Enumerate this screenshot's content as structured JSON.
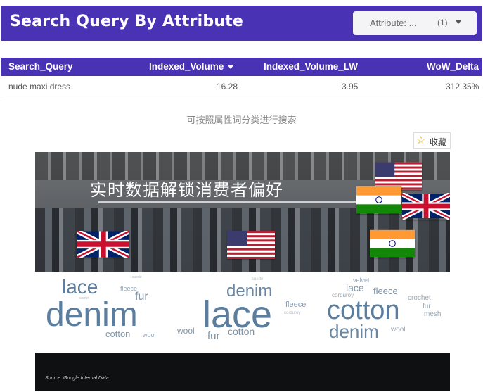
{
  "header": {
    "title": "Search Query By Attribute"
  },
  "attribute_select": {
    "label": "Attribute: ...",
    "count": "(1)"
  },
  "table": {
    "columns": [
      "Search_Query",
      "Indexed_Volume",
      "Indexed_Volume_LW",
      "WoW_Delta"
    ],
    "rows": [
      {
        "query": "nude maxi dress",
        "indexed_volume": "16.28",
        "indexed_volume_lw": "3.95",
        "wow_delta": "312.35%"
      }
    ]
  },
  "caption": "可按照属性词分类进行搜索",
  "favorite": {
    "icon": "star-outline-icon",
    "label": "收藏"
  },
  "image": {
    "title": "实时数据解锁消费者偏好",
    "source": "Source: Google Internal Data",
    "clouds": [
      {
        "words": [
          "lace",
          "fleece",
          "fur",
          "denim",
          "cotton",
          "wool",
          "suede",
          "scarlet"
        ]
      },
      {
        "words": [
          "suede",
          "denim",
          "lace",
          "fleece",
          "corduroy",
          "cotton",
          "wool",
          "fur"
        ]
      },
      {
        "words": [
          "velvet",
          "lace",
          "corduroy",
          "fleece",
          "crochet",
          "cotton",
          "fur",
          "mesh",
          "denim",
          "wool"
        ]
      }
    ]
  },
  "colors": {
    "header_bg": "#4a32b4",
    "word_primary": "#5b7e9e",
    "word_secondary": "#9aa7b3"
  }
}
